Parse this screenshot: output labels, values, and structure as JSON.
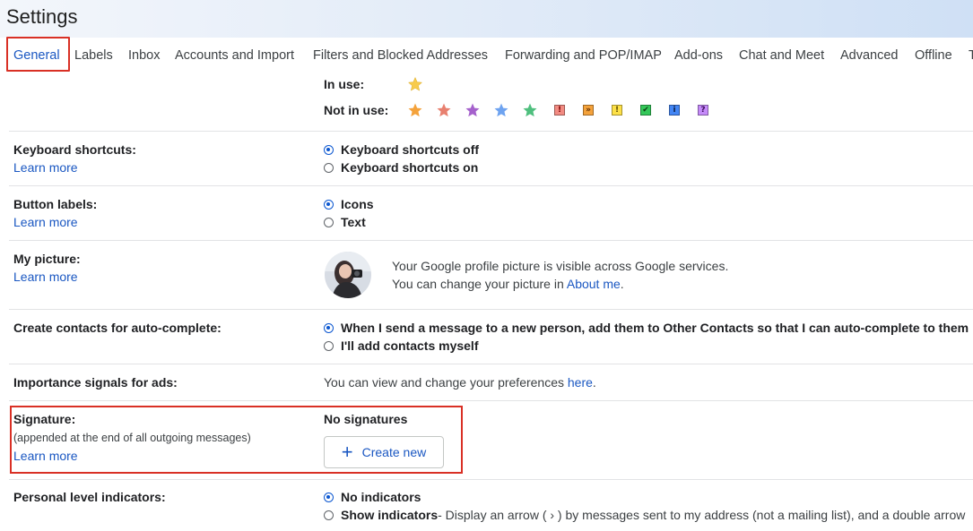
{
  "header": {
    "title": "Settings"
  },
  "tabs": [
    {
      "label": "General",
      "active": true
    },
    {
      "label": "Labels"
    },
    {
      "label": "Inbox"
    },
    {
      "label": "Accounts and Import"
    },
    {
      "label": "Filters and Blocked Addresses"
    },
    {
      "label": "Forwarding and POP/IMAP"
    },
    {
      "label": "Add-ons"
    },
    {
      "label": "Chat and Meet"
    },
    {
      "label": "Advanced"
    },
    {
      "label": "Offline"
    },
    {
      "label": "T"
    }
  ],
  "stars": {
    "in_use_label": "In use:",
    "not_in_use_label": "Not in use:",
    "in_use": [
      {
        "icon": "yellow-star-icon",
        "color": "#f7cb4d"
      }
    ],
    "not_in_use": [
      {
        "icon": "orange-star-icon",
        "color": "#f4a23b"
      },
      {
        "icon": "red-star-icon",
        "color": "#e8806f"
      },
      {
        "icon": "purple-star-icon",
        "color": "#a561cc"
      },
      {
        "icon": "blue-star-icon",
        "color": "#6ea3f0"
      },
      {
        "icon": "green-star-icon",
        "color": "#4fbf7e"
      },
      {
        "icon": "red-bang-icon",
        "color": "#f28b82",
        "glyph": "!"
      },
      {
        "icon": "orange-guillemet-icon",
        "color": "#f4a23b",
        "glyph": "»"
      },
      {
        "icon": "yellow-bang-icon",
        "color": "#fde047",
        "glyph": "!"
      },
      {
        "icon": "green-check-icon",
        "color": "#34c759",
        "glyph": "✔"
      },
      {
        "icon": "blue-info-icon",
        "color": "#4285f4",
        "glyph": "i"
      },
      {
        "icon": "purple-question-icon",
        "color": "#c58af9",
        "glyph": "?"
      }
    ]
  },
  "keyboard": {
    "label": "Keyboard shortcuts:",
    "learn_more": "Learn more",
    "options": [
      "Keyboard shortcuts off",
      "Keyboard shortcuts on"
    ],
    "selected": 0
  },
  "button_labels": {
    "label": "Button labels:",
    "learn_more": "Learn more",
    "options": [
      "Icons",
      "Text"
    ],
    "selected": 0
  },
  "my_picture": {
    "label": "My picture:",
    "learn_more": "Learn more",
    "line1": "Your Google profile picture is visible across Google services.",
    "line2_prefix": "You can change your picture in ",
    "line2_link": "About me",
    "line2_suffix": "."
  },
  "contacts": {
    "label": "Create contacts for auto-complete:",
    "options": [
      "When I send a message to a new person, add them to Other Contacts so that I can auto-complete to them",
      "I'll add contacts myself"
    ],
    "selected": 0
  },
  "importance": {
    "label": "Importance signals for ads:",
    "text_prefix": "You can view and change your preferences ",
    "text_link": "here",
    "text_suffix": "."
  },
  "signature": {
    "label": "Signature:",
    "sub": "(appended at the end of all outgoing messages)",
    "learn_more": "Learn more",
    "status": "No signatures",
    "create_button": "Create new"
  },
  "personal_level": {
    "label": "Personal level indicators:",
    "option1": "No indicators",
    "option2": "Show indicators",
    "option2_desc": " - Display an arrow ( › ) by messages sent to my address (not a mailing list), and a double arrow",
    "selected": 0
  },
  "colors": {
    "link": "#1a57c2",
    "highlight": "#d93025",
    "radio": "#0b57d0"
  }
}
